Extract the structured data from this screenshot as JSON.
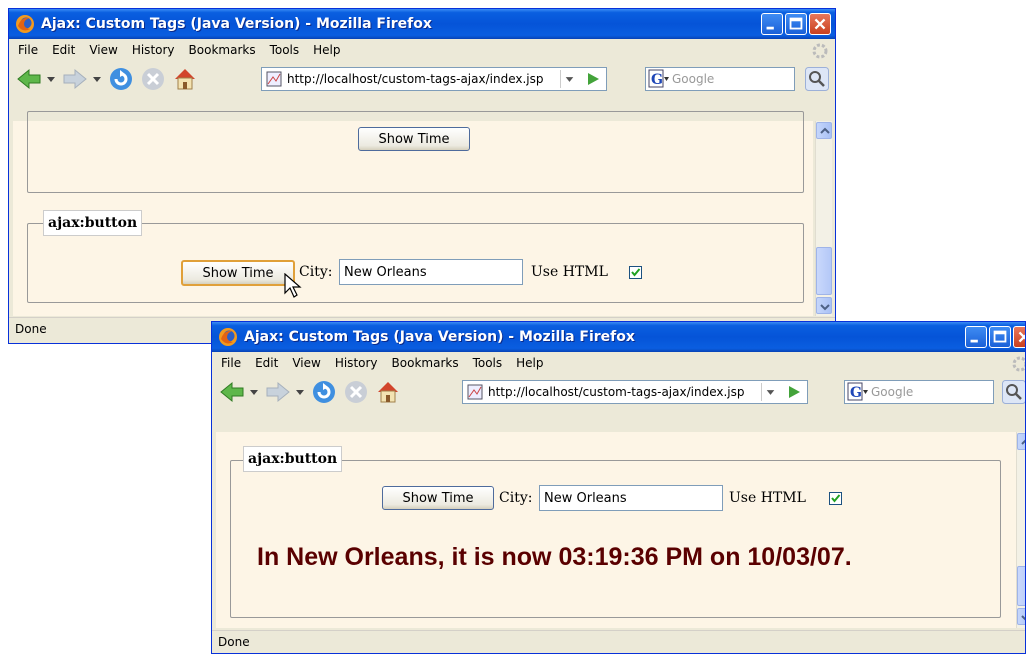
{
  "window1": {
    "title": "Ajax: Custom Tags (Java Version) - Mozilla Firefox",
    "menu": [
      "File",
      "Edit",
      "View",
      "History",
      "Bookmarks",
      "Tools",
      "Help"
    ],
    "url": "http://localhost/custom-tags-ajax/index.jsp",
    "search_placeholder": "Google",
    "top_button": "Show Time",
    "fieldset_legend": "ajax:button",
    "show_time_button": "Show Time",
    "city_label": "City:",
    "city_value": "New Orleans",
    "use_html_label": "Use HTML",
    "use_html_checked": true,
    "status": "Done"
  },
  "window2": {
    "title": "Ajax: Custom Tags (Java Version) - Mozilla Firefox",
    "menu": [
      "File",
      "Edit",
      "View",
      "History",
      "Bookmarks",
      "Tools",
      "Help"
    ],
    "url": "http://localhost/custom-tags-ajax/index.jsp",
    "search_placeholder": "Google",
    "fieldset_legend": "ajax:button",
    "show_time_button": "Show Time",
    "city_label": "City:",
    "city_value": "New Orleans",
    "use_html_label": "Use HTML",
    "use_html_checked": true,
    "result_text": "In New Orleans, it is now 03:19:36 PM on 10/03/07.",
    "status": "Done"
  },
  "colors": {
    "title_blue": "#0554d8",
    "content_bg": "#fdf5e6",
    "result_text": "#5a0000",
    "chrome": "#ece9d8"
  }
}
